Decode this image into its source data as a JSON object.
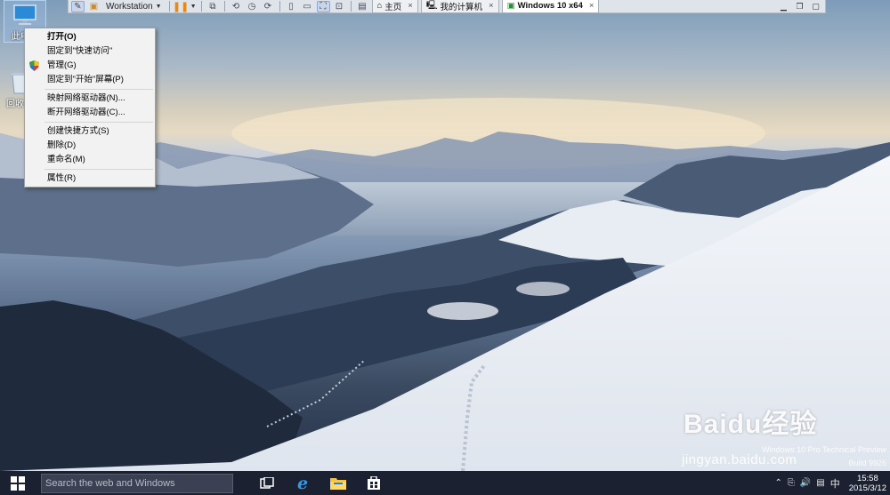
{
  "vm_toolbar": {
    "product_label": "Workstation",
    "tabs": [
      {
        "label": "主页",
        "icon": "home-icon"
      },
      {
        "label": "我的计算机",
        "icon": "computer-icon"
      },
      {
        "label": "Windows 10 x64",
        "icon": "vm-icon",
        "active": true
      }
    ],
    "close_glyph": "×"
  },
  "desktop_icons": [
    {
      "label": "此电脑",
      "icon": "this-pc-icon"
    },
    {
      "label": "回收站",
      "icon": "recycle-bin-icon"
    }
  ],
  "context_menu": {
    "groups": [
      [
        {
          "label": "打开(O)",
          "bold": true
        },
        {
          "label": "固定到\"快速访问\""
        },
        {
          "label": "管理(G)",
          "icon": "uac-shield-icon"
        },
        {
          "label": "固定到\"开始\"屏幕(P)"
        }
      ],
      [
        {
          "label": "映射网络驱动器(N)..."
        },
        {
          "label": "断开网络驱动器(C)..."
        }
      ],
      [
        {
          "label": "创建快捷方式(S)"
        },
        {
          "label": "删除(D)"
        },
        {
          "label": "重命名(M)"
        }
      ],
      [
        {
          "label": "属性(R)"
        }
      ]
    ]
  },
  "watermark": {
    "os_line1": "Windows 10 Pro Technical Preview",
    "os_line2": "Build 9926",
    "baidu_logo": "Baidu经验",
    "baidu_url": "jingyan.baidu.com"
  },
  "taskbar": {
    "search_placeholder": "Search the web and Windows",
    "apps": [
      "task-view-icon",
      "internet-explorer-icon",
      "file-explorer-icon",
      "store-icon"
    ],
    "tray": {
      "ime": "中",
      "time": "15:58",
      "date": "2015/3/12"
    }
  },
  "colors": {
    "taskbar": "#1b2130",
    "menu_bg": "#f2f2f2",
    "accent": "#1e88e5"
  }
}
